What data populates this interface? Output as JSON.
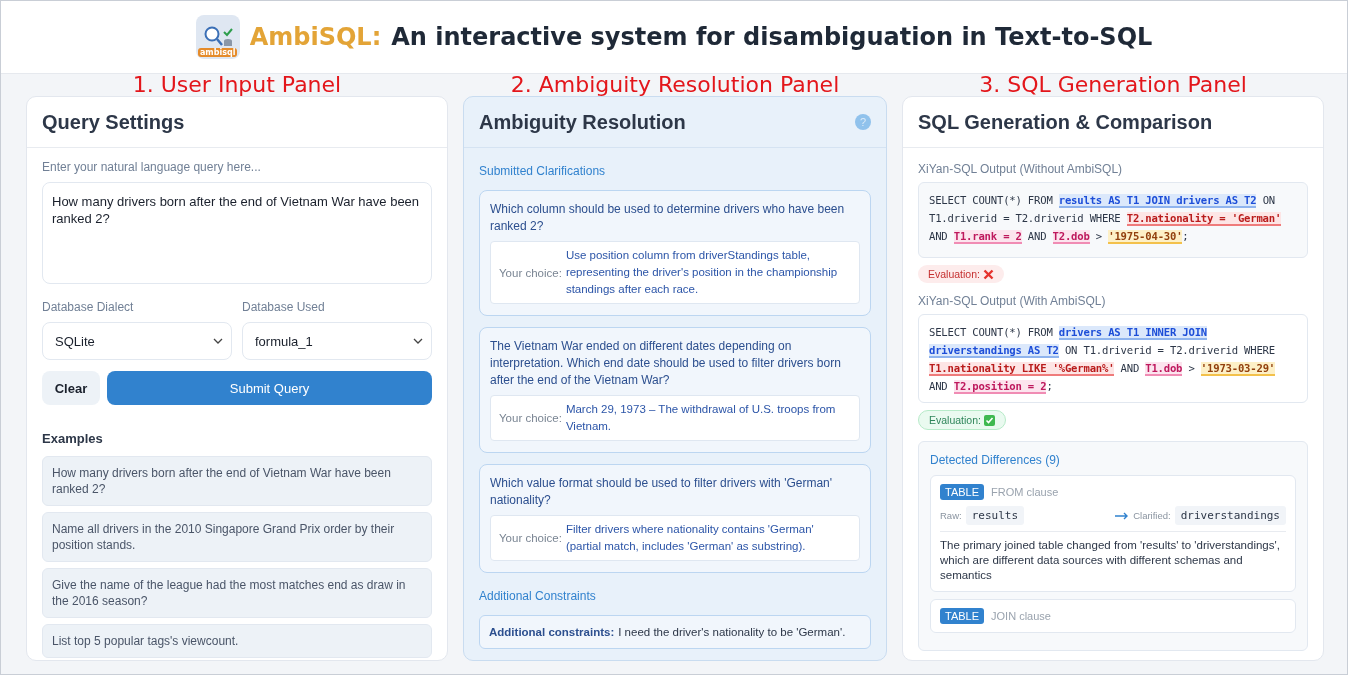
{
  "header": {
    "logo_text": "ambisql",
    "app_name": "AmbiSQL:",
    "subtitle": "An interactive system for disambiguation in Text-to-SQL"
  },
  "panel_captions": [
    "1. User Input Panel",
    "2. Ambiguity Resolution Panel",
    "3. SQL Generation Panel"
  ],
  "query_settings": {
    "title": "Query Settings",
    "query_label": "Enter your natural language query here...",
    "query_value": "How many drivers born after the end of Vietnam War have been ranked 2?",
    "selects": [
      {
        "label": "Database Dialect",
        "value": "SQLite"
      },
      {
        "label": "Database Used",
        "value": "formula_1"
      }
    ],
    "buttons": [
      {
        "label": "Clear",
        "kind": "secondary"
      },
      {
        "label": "Submit Query",
        "kind": "primary"
      }
    ],
    "examples_title": "Examples",
    "examples": [
      "How many drivers born after the end of Vietnam War have been ranked 2?",
      "Name all drivers in the 2010 Singapore Grand Prix order by their position stands.",
      "Give the name of the league had the most matches end as draw in the 2016 season?",
      "List top 5 popular tags's viewcount."
    ]
  },
  "ambiguity": {
    "title": "Ambiguity Resolution",
    "help": "?",
    "section": "Submitted Clarifications",
    "clarifications": [
      {
        "question": "Which column should be used to determine drivers who have been ranked 2?",
        "choice_label": "Your choice:",
        "choice": "Use position column from driverStandings table, representing the driver's position in the championship standings after each race."
      },
      {
        "question": "The Vietnam War ended on different dates depending on interpretation. Which end date should be used to filter drivers born after the end of the Vietnam War?",
        "choice_label": "Your choice:",
        "choice": "March 29, 1973 – The withdrawal of U.S. troops from Vietnam."
      },
      {
        "question": "Which value format should be used to filter drivers with 'German' nationality?",
        "choice_label": "Your choice:",
        "choice": "Filter drivers where nationality contains 'German' (partial match, includes 'German' as substring)."
      }
    ],
    "constraints_section": "Additional Constraints",
    "constraints_label": "Additional constraints:",
    "constraints_text": "I need the driver's nationality to be 'German'."
  },
  "sql": {
    "title": "SQL Generation & Comparison",
    "outputs": [
      {
        "label": "XiYan-SQL Output (Without AmbiSQL)",
        "segments": [
          {
            "text": "SELECT COUNT(*) FROM ",
            "kind": "plain"
          },
          {
            "text": "results AS T1 JOIN drivers AS T2",
            "kind": "table"
          },
          {
            "text": " ON T1.driverid = T2.driverid WHERE ",
            "kind": "plain"
          },
          {
            "text": "T2.nationality = 'German'",
            "kind": "filter"
          },
          {
            "text": " AND ",
            "kind": "plain"
          },
          {
            "text": "T1.rank = 2",
            "kind": "column"
          },
          {
            "text": " AND ",
            "kind": "plain"
          },
          {
            "text": "T2.dob",
            "kind": "column"
          },
          {
            "text": " > ",
            "kind": "plain"
          },
          {
            "text": "'1975-04-30'",
            "kind": "literal"
          },
          {
            "text": ";",
            "kind": "plain"
          }
        ],
        "evaluation": {
          "label": "Evaluation:",
          "passed": false
        }
      },
      {
        "label": "XiYan-SQL Output (With AmbiSQL)",
        "segments": [
          {
            "text": "SELECT COUNT(*) FROM ",
            "kind": "plain"
          },
          {
            "text": "drivers AS T1 INNER JOIN driverstandings AS T2",
            "kind": "table"
          },
          {
            "text": " ON T1.driverid = T2.driverid WHERE ",
            "kind": "plain"
          },
          {
            "text": "T1.nationality LIKE '%German%'",
            "kind": "filter"
          },
          {
            "text": " AND ",
            "kind": "plain"
          },
          {
            "text": "T1.dob",
            "kind": "column"
          },
          {
            "text": " > ",
            "kind": "plain"
          },
          {
            "text": "'1973-03-29'",
            "kind": "literal"
          },
          {
            "text": " AND ",
            "kind": "plain"
          },
          {
            "text": "T2.position = 2",
            "kind": "column"
          },
          {
            "text": ";",
            "kind": "plain"
          }
        ],
        "evaluation": {
          "label": "Evaluation:",
          "passed": true
        }
      }
    ],
    "differences": {
      "title": "Detected Differences (9)",
      "items": [
        {
          "type": "TABLE",
          "clause": "FROM clause",
          "raw_label": "Raw:",
          "raw": "results",
          "clarified_label": "Clarified:",
          "clarified": "driverstandings",
          "explanation": "The primary joined table changed from 'results' to 'driverstandings', which are different data sources with different schemas and semantics"
        },
        {
          "type": "TABLE",
          "clause": "JOIN clause"
        }
      ]
    }
  }
}
